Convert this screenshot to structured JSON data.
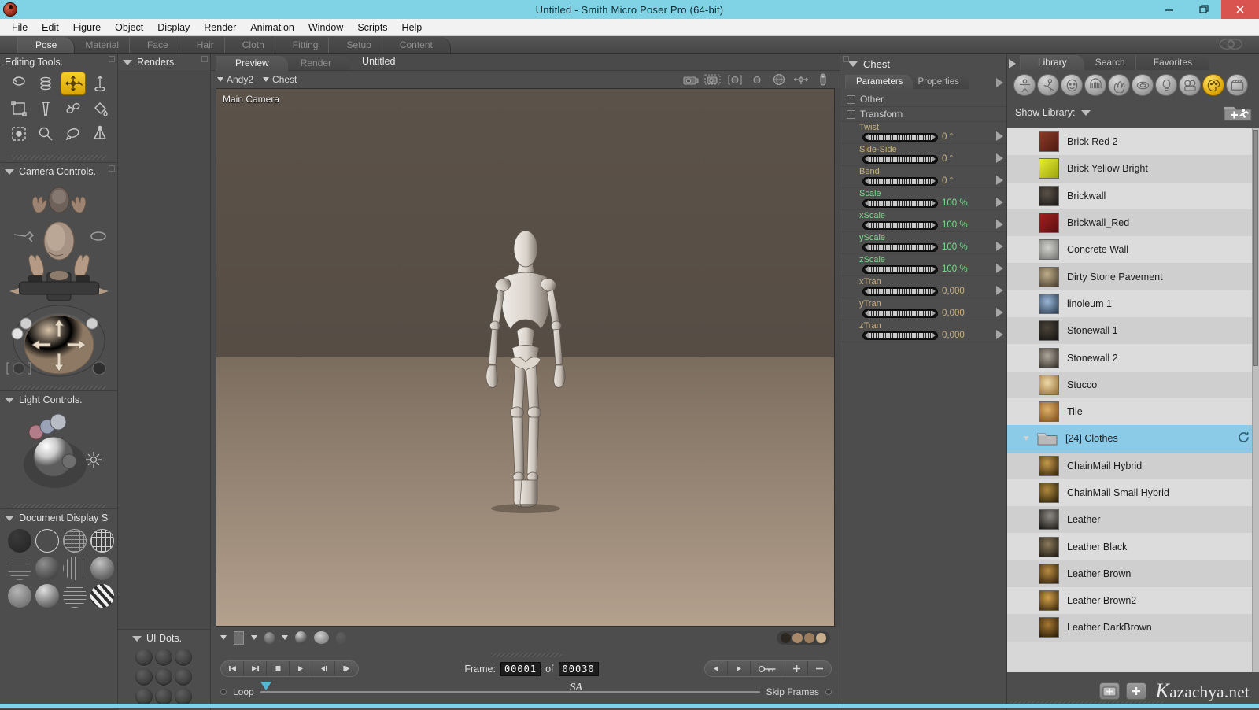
{
  "titlebar": {
    "title": "Untitled - Smith Micro Poser Pro  (64-bit)",
    "minimize_label": "–",
    "restore_label": "❐",
    "close_label": "✕"
  },
  "menubar": {
    "items": [
      "File",
      "Edit",
      "Figure",
      "Object",
      "Display",
      "Render",
      "Animation",
      "Window",
      "Scripts",
      "Help"
    ]
  },
  "room_tabs": {
    "items": [
      {
        "label": "Pose",
        "active": true
      },
      {
        "label": "Material",
        "active": false
      },
      {
        "label": "Face",
        "active": false
      },
      {
        "label": "Hair",
        "active": false
      },
      {
        "label": "Cloth",
        "active": false
      },
      {
        "label": "Fitting",
        "active": false
      },
      {
        "label": "Setup",
        "active": false
      },
      {
        "label": "Content",
        "active": false
      }
    ]
  },
  "editing_tools": {
    "title": "Editing Tools.",
    "tools": [
      {
        "name": "rotate-tool",
        "active": false
      },
      {
        "name": "twist-tool",
        "active": false
      },
      {
        "name": "translate-pull-tool",
        "active": true
      },
      {
        "name": "translate-inout-tool",
        "active": false
      },
      {
        "name": "scale-tool",
        "active": false
      },
      {
        "name": "taper-tool",
        "active": false
      },
      {
        "name": "chain-break-tool",
        "active": false
      },
      {
        "name": "color-tool",
        "active": false
      },
      {
        "name": "grouping-tool",
        "active": false
      },
      {
        "name": "morph-putty-tool",
        "active": false
      },
      {
        "name": "view-magnifier-tool",
        "active": false
      },
      {
        "name": "direct-manipulation-tool",
        "active": false
      }
    ]
  },
  "camera_controls": {
    "title": "Camera Controls."
  },
  "light_controls": {
    "title": "Light Controls."
  },
  "document_display": {
    "title": "Document Display S",
    "styles": [
      "silhouette",
      "outline",
      "wireframe",
      "hidden-line",
      "lit-wireframe",
      "flat-shaded",
      "flat-lined",
      "smooth-shaded",
      "smooth-lined",
      "texture-shaded",
      "texture-lined",
      "cartoon"
    ]
  },
  "renders_panel": {
    "title": "Renders."
  },
  "ui_dots": {
    "title": "UI Dots.",
    "count": 9
  },
  "document": {
    "tabs": [
      {
        "label": "Preview",
        "active": true
      },
      {
        "label": "Render",
        "active": false
      }
    ],
    "doc_name": "Untitled",
    "figure_selector": "Andy2",
    "actor_selector": "Chest",
    "camera_label": "Main Camera",
    "toolbar_icons": [
      "camera-icon",
      "camera-dotted-icon",
      "light-bracket-icon",
      "light-ball-icon",
      "globe-icon",
      "bones-icon",
      "lamp-icon"
    ],
    "bottom_icons": [
      "dropdown-tri-1",
      "square-icon",
      "dropdown-tri-2",
      "ball-icon",
      "dropdown-tri-3",
      "shadow-ball-icon",
      "multi-ball-icon",
      "ghost-ball-icon"
    ],
    "dot_colors": [
      "#2c2620",
      "#a8896a",
      "#9a7c5c",
      "#c8ae8c"
    ],
    "viewport_colors": {
      "backdrop_top": "#5b5249",
      "backdrop_bottom": "#564d45",
      "floor_near": "#b4a08d",
      "floor_far": "#7b6d5e",
      "figure": "#d9d2cb"
    }
  },
  "animation": {
    "transport": [
      "skip-to-start",
      "skip-to-end",
      "stop",
      "play",
      "step-back",
      "step-forward"
    ],
    "frame_label": "Frame:",
    "frame_current": "00001",
    "frame_of_label": "of",
    "frame_total": "00030",
    "key_controls": [
      "prev-key",
      "next-key",
      "key-icon",
      "add-key",
      "remove-key"
    ],
    "loop_label": "Loop",
    "skip_frames_label": "Skip Frames",
    "track_marker_label": "SA"
  },
  "parameters": {
    "actor_title": "Chest",
    "tabs": [
      {
        "label": "Parameters",
        "active": true
      },
      {
        "label": "Properties",
        "active": false
      }
    ],
    "groups": [
      {
        "label": "Other",
        "collapsed_sign": "−"
      },
      {
        "label": "Transform",
        "collapsed_sign": "−"
      }
    ],
    "dials": [
      {
        "label": "Twist",
        "value": "0 °",
        "color_class": "rot"
      },
      {
        "label": "Side-Side",
        "value": "0 °",
        "color_class": "rot"
      },
      {
        "label": "Bend",
        "value": "0 °",
        "color_class": "rot"
      },
      {
        "label": "Scale",
        "value": "100 %",
        "color_class": "scale"
      },
      {
        "label": "xScale",
        "value": "100 %",
        "color_class": "scale"
      },
      {
        "label": "yScale",
        "value": "100 %",
        "color_class": "scale"
      },
      {
        "label": "zScale",
        "value": "100 %",
        "color_class": "scale"
      },
      {
        "label": "xTran",
        "value": "0,000",
        "color_class": "tran"
      },
      {
        "label": "yTran",
        "value": "0,000",
        "color_class": "tran"
      },
      {
        "label": "zTran",
        "value": "0,000",
        "color_class": "tran"
      }
    ]
  },
  "library": {
    "tabs": [
      {
        "label": "Library",
        "active": true
      },
      {
        "label": "Search",
        "active": false
      },
      {
        "label": "Favorites",
        "active": false
      }
    ],
    "categories": [
      {
        "name": "figures-icon",
        "active": false
      },
      {
        "name": "poses-icon",
        "active": false
      },
      {
        "name": "expressions-icon",
        "active": false
      },
      {
        "name": "hair-icon",
        "active": false
      },
      {
        "name": "hands-icon",
        "active": false
      },
      {
        "name": "props-icon",
        "active": false
      },
      {
        "name": "lights-icon",
        "active": false
      },
      {
        "name": "cameras-icon",
        "active": false
      },
      {
        "name": "materials-icon",
        "active": true
      },
      {
        "name": "scenes-icon",
        "active": false
      }
    ],
    "show_library_label": "Show Library:",
    "add_folder_icon": "add-folder-icon",
    "items": [
      {
        "label": "Brick Red 2",
        "type": "material",
        "thumb": "#7a3626",
        "selected": false
      },
      {
        "label": "Brick Yellow Bright",
        "type": "material",
        "thumb": "#d8e01a",
        "selected": false
      },
      {
        "label": "Brickwall",
        "type": "material",
        "thumb": "#2a2520",
        "selected": false
      },
      {
        "label": "Brickwall_Red",
        "type": "material",
        "thumb": "#8e1c1c",
        "selected": false
      },
      {
        "label": "Concrete Wall",
        "type": "material",
        "thumb": "#9a9a96",
        "selected": false
      },
      {
        "label": "Dirty Stone Pavement",
        "type": "material",
        "thumb": "#6b5c44",
        "selected": false
      },
      {
        "label": "linoleum 1",
        "type": "material",
        "thumb": "#3f5a75",
        "selected": false
      },
      {
        "label": "Stonewall 1",
        "type": "material",
        "thumb": "#232019",
        "selected": false
      },
      {
        "label": "Stonewall 2",
        "type": "material",
        "thumb": "#4a443c",
        "selected": false
      },
      {
        "label": "Stucco",
        "type": "material",
        "thumb": "#c09a5e",
        "selected": false
      },
      {
        "label": "Tile",
        "type": "material",
        "thumb": "#b07a3a",
        "selected": false
      },
      {
        "label": "[24]  Clothes",
        "type": "folder",
        "thumb": "#a9a9a9",
        "selected": true
      },
      {
        "label": "ChainMail Hybrid",
        "type": "material",
        "thumb": "#6a4a20",
        "selected": false
      },
      {
        "label": "ChainMail Small Hybrid",
        "type": "material",
        "thumb": "#5c4520",
        "selected": false
      },
      {
        "label": "Leather",
        "type": "material",
        "thumb": "#2e2a26",
        "selected": false
      },
      {
        "label": "Leather Black",
        "type": "material",
        "thumb": "#3a3128",
        "selected": false
      },
      {
        "label": "Leather Brown",
        "type": "material",
        "thumb": "#63451f",
        "selected": false
      },
      {
        "label": "Leather Brown2",
        "type": "material",
        "thumb": "#7a5524",
        "selected": false
      },
      {
        "label": "Leather DarkBrown",
        "type": "material",
        "thumb": "#54391a",
        "selected": false
      }
    ],
    "footer": {
      "add_library_icon": "add-to-library-icon",
      "add_icon": "plus-icon",
      "watermark_first": "K",
      "watermark_rest": "azachya.net"
    }
  },
  "colors": {
    "title_bar": "#7fd3e4",
    "accent_yellow": "#e0a90d",
    "selection_blue": "#8ccbe8",
    "panel_gray": "#4d4d4d",
    "rotation_param": "#c7b47e",
    "scale_param": "#7fd98f",
    "translate_param": "#c9b184"
  }
}
